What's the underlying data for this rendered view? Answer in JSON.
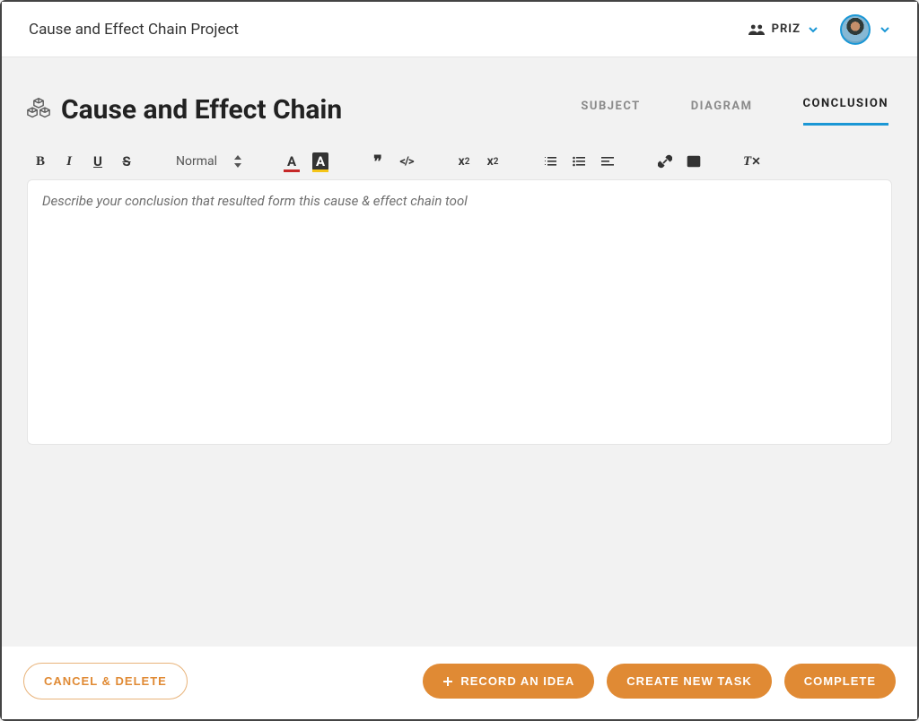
{
  "colors": {
    "accent_blue": "#1b97d5",
    "accent_orange": "#e08a34"
  },
  "header": {
    "project_title": "Cause and Effect Chain Project",
    "workspace_label": "PRIZ"
  },
  "page": {
    "title": "Cause and Effect Chain"
  },
  "tabs": [
    {
      "label": "SUBJECT",
      "active": false
    },
    {
      "label": "DIAGRAM",
      "active": false
    },
    {
      "label": "CONCLUSION",
      "active": true
    }
  ],
  "toolbar": {
    "format_label": "Normal",
    "icons": {
      "bold": "bold-icon",
      "italic": "italic-icon",
      "underline": "underline-icon",
      "strike": "strike-icon",
      "text_color": "text-color-icon",
      "bg_color": "background-color-icon",
      "quote": "quote-icon",
      "code": "code-icon",
      "subscript": "subscript-icon",
      "superscript": "superscript-icon",
      "ordered_list": "ordered-list-icon",
      "unordered_list": "unordered-list-icon",
      "align": "align-icon",
      "link": "link-icon",
      "image": "image-icon",
      "clear_format": "clear-format-icon"
    }
  },
  "editor": {
    "placeholder": "Describe your conclusion that resulted form this cause & effect chain tool",
    "value": ""
  },
  "footer": {
    "cancel_label": "CANCEL & DELETE",
    "record_idea_label": "RECORD AN IDEA",
    "create_task_label": "CREATE NEW TASK",
    "complete_label": "COMPLETE"
  }
}
